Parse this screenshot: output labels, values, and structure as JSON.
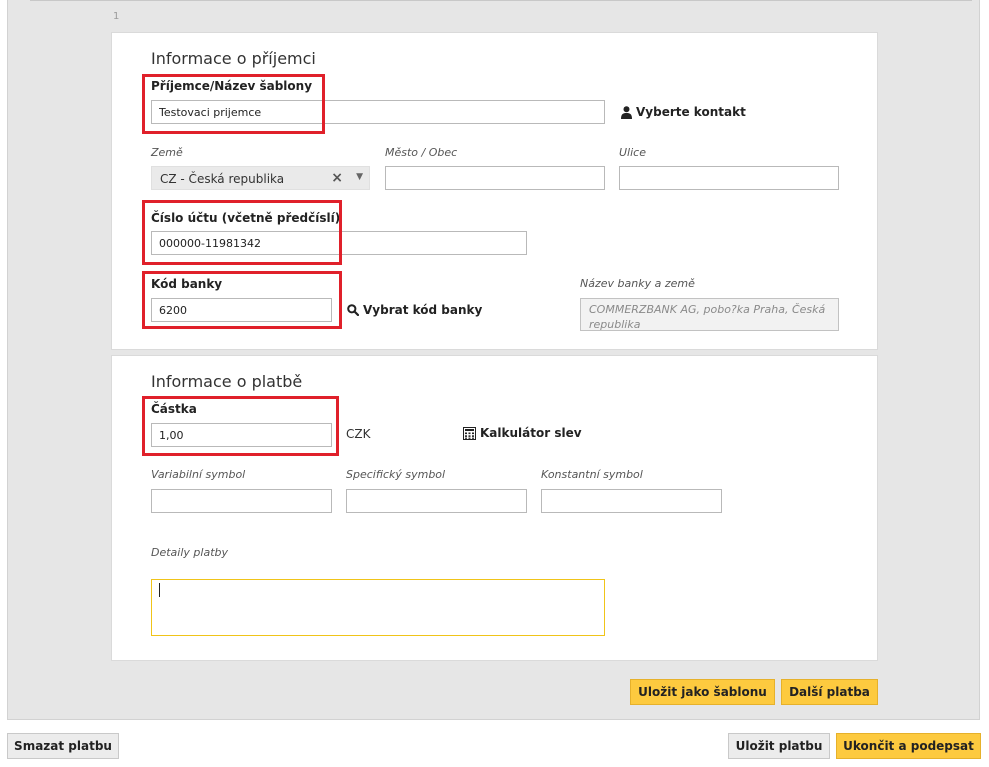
{
  "step_number": "1",
  "recipient": {
    "heading": "Informace o příjemci",
    "name_label": "Příjemce/Název šablony",
    "name_value": "Testovaci prijemce",
    "select_contact": "Vyberte kontakt",
    "country_label": "Země",
    "country_value": "CZ - Česká republika",
    "city_label": "Město / Obec",
    "city_value": "",
    "street_label": "Ulice",
    "street_value": "",
    "account_label": "Číslo účtu (včetně předčíslí)",
    "account_value": "000000-11981342",
    "bank_code_label": "Kód banky",
    "bank_code_value": "6200",
    "select_bank_code": "Vybrat kód banky",
    "bank_name_label": "Název banky a země",
    "bank_name_value": "COMMERZBANK AG, pobo?ka Praha, Česká republika"
  },
  "payment": {
    "heading": "Informace o platbě",
    "amount_label": "Částka",
    "amount_value": "1,00",
    "currency": "CZK",
    "discount_calc": "Kalkulátor slev",
    "variable_symbol_label": "Variabilní symbol",
    "variable_symbol_value": "",
    "specific_symbol_label": "Specifický symbol",
    "specific_symbol_value": "",
    "constant_symbol_label": "Konstantní symbol",
    "constant_symbol_value": "",
    "details_label": "Detaily platby",
    "details_value": ""
  },
  "buttons": {
    "save_template": "Uložit jako šablonu",
    "next_payment": "Další platba",
    "delete_payment": "Smazat platbu",
    "save_payment": "Uložit platbu",
    "finish_sign": "Ukončit a podepsat"
  },
  "icons": {
    "contact": "user-icon",
    "search": "search-icon",
    "calculator": "calculator-icon",
    "clear": "clear-icon",
    "dropdown": "chevron-down-icon"
  },
  "colors": {
    "highlight": "#e0202a",
    "accent_yellow": "#fdca3f",
    "focus_border": "#f0c419"
  }
}
